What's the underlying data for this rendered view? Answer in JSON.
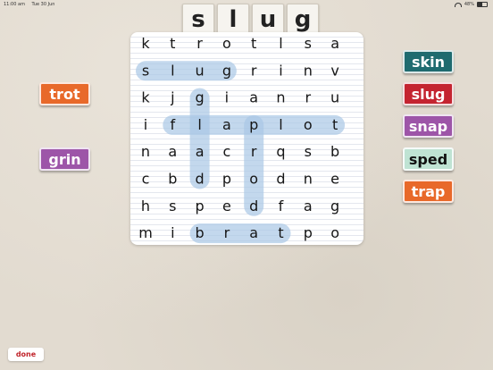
{
  "status": {
    "time": "11:00 am",
    "date": "Tue 30 Jun",
    "battery": "48%",
    "wifi_icon": "wifi-icon",
    "battery_icon": "battery-icon"
  },
  "target_word": [
    "s",
    "l",
    "u",
    "g"
  ],
  "grid": {
    "rows": [
      [
        "k",
        "t",
        "r",
        "o",
        "t",
        "l",
        "s",
        "a"
      ],
      [
        "s",
        "l",
        "u",
        "g",
        "r",
        "i",
        "n",
        "v"
      ],
      [
        "k",
        "j",
        "g",
        "i",
        "a",
        "n",
        "r",
        "u"
      ],
      [
        "i",
        "f",
        "l",
        "a",
        "p",
        "l",
        "o",
        "t"
      ],
      [
        "n",
        "a",
        "a",
        "c",
        "r",
        "q",
        "s",
        "b"
      ],
      [
        "c",
        "b",
        "d",
        "p",
        "o",
        "d",
        "n",
        "e"
      ],
      [
        "h",
        "s",
        "p",
        "e",
        "d",
        "f",
        "a",
        "g"
      ],
      [
        "m",
        "i",
        "b",
        "r",
        "a",
        "t",
        "p",
        "o"
      ]
    ],
    "highlight_color": "#a9c7e6",
    "highlights": [
      {
        "word": "slug",
        "from": [
          1,
          0
        ],
        "to": [
          1,
          3
        ]
      },
      {
        "word": "flaplot",
        "from": [
          3,
          1
        ],
        "to": [
          3,
          7
        ]
      },
      {
        "word": "glad",
        "from": [
          2,
          2
        ],
        "to": [
          5,
          2
        ]
      },
      {
        "word": "prod",
        "from": [
          3,
          4
        ],
        "to": [
          6,
          4
        ]
      },
      {
        "word": "brat",
        "from": [
          7,
          2
        ],
        "to": [
          7,
          5
        ]
      }
    ]
  },
  "left_words": [
    {
      "label": "trot",
      "color": "#e8692a"
    },
    {
      "label": "grin",
      "color": "#9d55a8"
    }
  ],
  "right_words": [
    {
      "label": "skin",
      "color": "#1f6b6f"
    },
    {
      "label": "slug",
      "color": "#c42430"
    },
    {
      "label": "snap",
      "color": "#9d55a8"
    },
    {
      "label": "sped",
      "color": "#bfe3d3",
      "found": true
    },
    {
      "label": "trap",
      "color": "#e8692a"
    }
  ],
  "done_label": "done"
}
